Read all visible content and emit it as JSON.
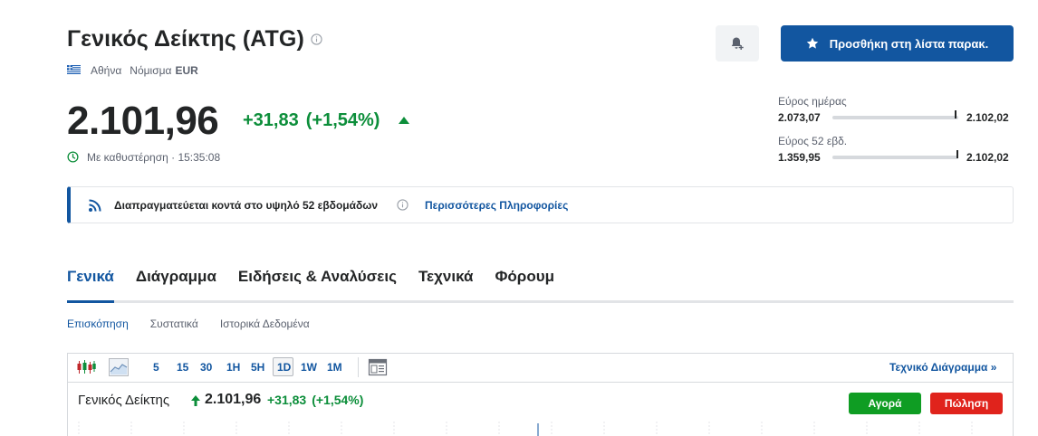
{
  "header": {
    "title": "Γενικός Δείκτης (ATG)",
    "exchange": "Αθήνα",
    "currency_label": "Νόμισμα",
    "currency": "EUR"
  },
  "actions": {
    "watchlist_label": "Προσθήκη στη λίστα παρακ."
  },
  "quote": {
    "price": "2.101,96",
    "change": "+31,83",
    "change_pct": "(+1,54%)",
    "delay_text": "Με καθυστέρηση · 15:35:08"
  },
  "ranges": {
    "day": {
      "label": "Εύρος ημέρας",
      "low": "2.073,07",
      "high": "2.102,02",
      "position": 0.98
    },
    "week52": {
      "label": "Εύρος 52 εβδ.",
      "low": "1.359,95",
      "high": "2.102,02",
      "position": 0.99
    }
  },
  "banner": {
    "text": "Διαπραγματεύεται κοντά στο υψηλό 52 εβδομάδων",
    "link": "Περισσότερες Πληροφορίες"
  },
  "tabs": [
    {
      "label": "Γενικά",
      "active": true
    },
    {
      "label": "Διάγραμμα"
    },
    {
      "label": "Ειδήσεις & Αναλύσεις"
    },
    {
      "label": "Τεχνικά"
    },
    {
      "label": "Φόρουμ"
    }
  ],
  "subtabs": [
    {
      "label": "Επισκόπηση",
      "active": true
    },
    {
      "label": "Συστατικά"
    },
    {
      "label": "Ιστορικά Δεδομένα"
    }
  ],
  "chart_toolbar": {
    "timeframes": [
      "5",
      "15",
      "30",
      "1H",
      "5H",
      "1D",
      "1W",
      "1M"
    ],
    "selected": "1D",
    "tech_link": "Τεχνικό Διάγραμμα »"
  },
  "chart": {
    "name": "Γενικός Δείκτης",
    "price": "2.101,96",
    "change": "+31,83",
    "change_pct": "(+1,54%)",
    "buy_label": "Αγορά",
    "sell_label": "Πώληση"
  },
  "colors": {
    "accent": "#1256a0",
    "positive": "#0c8e3a",
    "buy": "#0f9d23",
    "sell": "#e0231c"
  }
}
